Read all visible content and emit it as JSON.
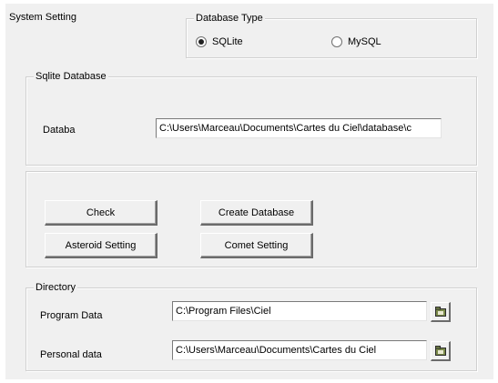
{
  "tab": {
    "title": "System Setting"
  },
  "database_type": {
    "legend": "Database Type",
    "options": [
      {
        "label": "SQLite",
        "selected": true
      },
      {
        "label": "MySQL",
        "selected": false
      }
    ]
  },
  "sqlite_database": {
    "legend": "Sqlite Database",
    "label": "Databa",
    "value": "C:\\Users\\Marceau\\Documents\\Cartes du Ciel\\database\\c"
  },
  "actions": {
    "check": "Check",
    "create_database": "Create Database",
    "asteroid_setting": "Asteroid Setting",
    "comet_setting": "Comet Setting"
  },
  "directory": {
    "legend": "Directory",
    "program_data_label": "Program Data",
    "program_data_value": "C:\\Program Files\\Ciel",
    "personal_data_label": "Personal data",
    "personal_data_value": "C:\\Users\\Marceau\\Documents\\Cartes du Ciel"
  },
  "icons": {
    "browse": "folder-icon"
  }
}
